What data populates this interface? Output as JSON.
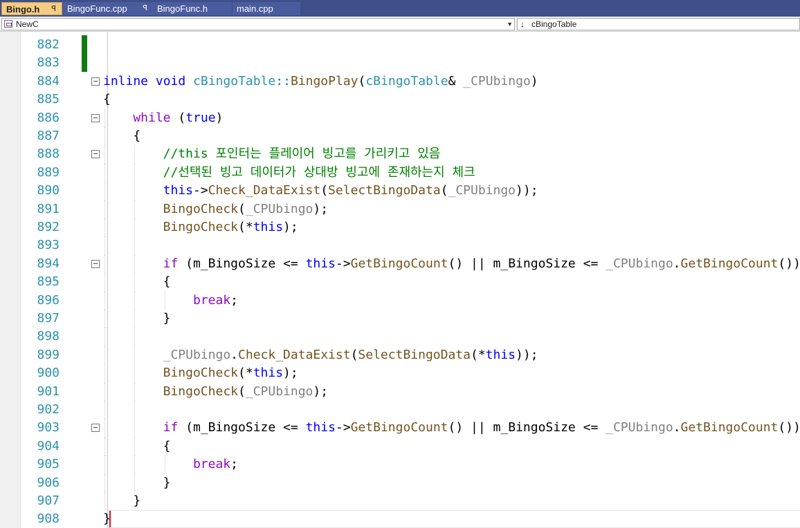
{
  "tabs": [
    {
      "label": "Bingo.h",
      "pin": "ꟼ",
      "active": true
    },
    {
      "label": "BingoFunc.cpp",
      "pin": "ꟼ",
      "active": false
    },
    {
      "label": "BingoFunc.h",
      "pin": "",
      "active": false
    },
    {
      "label": "main.cpp",
      "pin": "",
      "active": false
    }
  ],
  "navigation": {
    "scope": "NewC",
    "member_arrow": "↓",
    "member": "cBingoTable"
  },
  "editor": {
    "lines": [
      {
        "n": "882",
        "fold": false,
        "indent": 0,
        "tokens": []
      },
      {
        "n": "883",
        "fold": false,
        "indent": 0,
        "tokens": []
      },
      {
        "n": "884",
        "fold": true,
        "indent": 0,
        "tokens": [
          [
            "kw",
            "inline"
          ],
          [
            "",
            ""
          ],
          [
            "kw",
            " void"
          ],
          [
            "",
            ""
          ],
          [
            "ty",
            " cBingoTable"
          ],
          [
            "op",
            "::"
          ],
          [
            "fn",
            "BingoPlay"
          ],
          [
            "",
            "("
          ],
          [
            "ty",
            "cBingoTable"
          ],
          [
            "",
            "&"
          ],
          [
            "pr",
            " _CPUbingo"
          ],
          [
            "",
            ")"
          ]
        ]
      },
      {
        "n": "885",
        "fold": false,
        "indent": 0,
        "tokens": [
          [
            "",
            "{"
          ]
        ]
      },
      {
        "n": "886",
        "fold": true,
        "indent": 1,
        "tokens": [
          [
            "ctl",
            "while"
          ],
          [
            "",
            " ("
          ],
          [
            "kw",
            "true"
          ],
          [
            "",
            ")"
          ]
        ]
      },
      {
        "n": "887",
        "fold": false,
        "indent": 1,
        "tokens": [
          [
            "",
            "{"
          ]
        ]
      },
      {
        "n": "888",
        "fold": true,
        "indent": 2,
        "tokens": [
          [
            "cm",
            "//this 포인터는 플레이어 빙고를 가리키고 있음"
          ]
        ]
      },
      {
        "n": "889",
        "fold": false,
        "indent": 2,
        "tokens": [
          [
            "cm",
            "//선택된 빙고 데이터가 상대방 빙고에 존재하는지 체크"
          ]
        ]
      },
      {
        "n": "890",
        "fold": false,
        "indent": 2,
        "tokens": [
          [
            "kw",
            "this"
          ],
          [
            "",
            "->"
          ],
          [
            "fn",
            "Check_DataExist"
          ],
          [
            "",
            "("
          ],
          [
            "fn",
            "SelectBingoData"
          ],
          [
            "",
            "("
          ],
          [
            "pr",
            "_CPUbingo"
          ],
          [
            "",
            "));"
          ]
        ]
      },
      {
        "n": "891",
        "fold": false,
        "indent": 2,
        "tokens": [
          [
            "fn",
            "BingoCheck"
          ],
          [
            "",
            "("
          ],
          [
            "pr",
            "_CPUbingo"
          ],
          [
            "",
            ");"
          ]
        ]
      },
      {
        "n": "892",
        "fold": false,
        "indent": 2,
        "tokens": [
          [
            "fn",
            "BingoCheck"
          ],
          [
            "",
            "(*"
          ],
          [
            "kw",
            "this"
          ],
          [
            "",
            ");"
          ]
        ]
      },
      {
        "n": "893",
        "fold": false,
        "indent": 2,
        "tokens": []
      },
      {
        "n": "894",
        "fold": true,
        "indent": 2,
        "tokens": [
          [
            "ctl",
            "if"
          ],
          [
            "",
            " ("
          ],
          [
            "mb",
            "m_BingoSize"
          ],
          [
            "",
            " <= "
          ],
          [
            "kw",
            "this"
          ],
          [
            "",
            "->"
          ],
          [
            "fn",
            "GetBingoCount"
          ],
          [
            "",
            "() || "
          ],
          [
            "mb",
            "m_BingoSize"
          ],
          [
            "",
            " <= "
          ],
          [
            "pr",
            "_CPUbingo"
          ],
          [
            "",
            "."
          ],
          [
            "fn",
            "GetBingoCount"
          ],
          [
            "",
            "())"
          ]
        ]
      },
      {
        "n": "895",
        "fold": false,
        "indent": 2,
        "tokens": [
          [
            "",
            "{"
          ]
        ]
      },
      {
        "n": "896",
        "fold": false,
        "indent": 3,
        "tokens": [
          [
            "ctl",
            "break"
          ],
          [
            "",
            ";"
          ]
        ]
      },
      {
        "n": "897",
        "fold": false,
        "indent": 2,
        "tokens": [
          [
            "",
            "}"
          ]
        ]
      },
      {
        "n": "898",
        "fold": false,
        "indent": 2,
        "tokens": []
      },
      {
        "n": "899",
        "fold": false,
        "indent": 2,
        "tokens": [
          [
            "pr",
            "_CPUbingo"
          ],
          [
            "",
            "."
          ],
          [
            "fn",
            "Check_DataExist"
          ],
          [
            "",
            "("
          ],
          [
            "fn",
            "SelectBingoData"
          ],
          [
            "",
            "(*"
          ],
          [
            "kw",
            "this"
          ],
          [
            "",
            "));"
          ]
        ]
      },
      {
        "n": "900",
        "fold": false,
        "indent": 2,
        "tokens": [
          [
            "fn",
            "BingoCheck"
          ],
          [
            "",
            "(*"
          ],
          [
            "kw",
            "this"
          ],
          [
            "",
            ");"
          ]
        ]
      },
      {
        "n": "901",
        "fold": false,
        "indent": 2,
        "tokens": [
          [
            "fn",
            "BingoCheck"
          ],
          [
            "",
            "("
          ],
          [
            "pr",
            "_CPUbingo"
          ],
          [
            "",
            ");"
          ]
        ]
      },
      {
        "n": "902",
        "fold": false,
        "indent": 2,
        "tokens": []
      },
      {
        "n": "903",
        "fold": true,
        "indent": 2,
        "tokens": [
          [
            "ctl",
            "if"
          ],
          [
            "",
            " ("
          ],
          [
            "mb",
            "m_BingoSize"
          ],
          [
            "",
            " <= "
          ],
          [
            "kw",
            "this"
          ],
          [
            "",
            "->"
          ],
          [
            "fn",
            "GetBingoCount"
          ],
          [
            "",
            "() || "
          ],
          [
            "mb",
            "m_BingoSize"
          ],
          [
            "",
            " <= "
          ],
          [
            "pr",
            "_CPUbingo"
          ],
          [
            "",
            "."
          ],
          [
            "fn",
            "GetBingoCount"
          ],
          [
            "",
            "())"
          ]
        ]
      },
      {
        "n": "904",
        "fold": false,
        "indent": 2,
        "tokens": [
          [
            "",
            "{"
          ]
        ]
      },
      {
        "n": "905",
        "fold": false,
        "indent": 3,
        "tokens": [
          [
            "ctl",
            "break"
          ],
          [
            "",
            ";"
          ]
        ]
      },
      {
        "n": "906",
        "fold": false,
        "indent": 2,
        "tokens": [
          [
            "",
            "}"
          ]
        ]
      },
      {
        "n": "907",
        "fold": false,
        "indent": 1,
        "tokens": [
          [
            "",
            "}"
          ]
        ]
      },
      {
        "n": "908",
        "fold": false,
        "indent": 0,
        "tokens": [
          [
            "",
            "}"
          ]
        ],
        "current": true
      }
    ]
  }
}
